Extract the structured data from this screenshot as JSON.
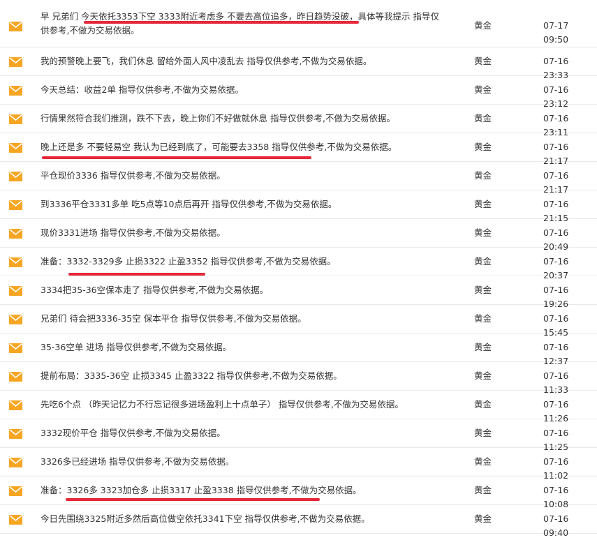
{
  "colors": {
    "icon": "#f6a623",
    "highlight": "#e5283a",
    "text": "#333333",
    "divider": "#e9e9e9"
  },
  "icon_name": "envelope-icon",
  "messages": [
    {
      "text": "早 兄弟们 今天依托3353下空 3333附近考虑多 不要去高位追多，昨日趋势没破，具体等我提示 指导仅供参考,不做为交易依据。",
      "category": "黄金",
      "time": "07-17 09:50",
      "highlighted": true
    },
    {
      "text": "我的预警晚上要飞，我们休息 留给外面人风中凌乱去 指导仅供参考,不做为交易依据。",
      "category": "黄金",
      "time": "07-16 23:33",
      "highlighted": false
    },
    {
      "text": "今天总结：收益2单 指导仅供参考,不做为交易依据。",
      "category": "黄金",
      "time": "07-16 23:12",
      "highlighted": false
    },
    {
      "text": "行情果然符合我们推测，跌不下去，晚上你们不好做就休息 指导仅供参考,不做为交易依据。",
      "category": "黄金",
      "time": "07-16 23:11",
      "highlighted": false
    },
    {
      "text": "晚上还是多 不要轻易空 我认为已经到底了，可能要去3358 指导仅供参考,不做为交易依据。",
      "category": "黄金",
      "time": "07-16 21:17",
      "highlighted": true
    },
    {
      "text": "平仓现价3336 指导仅供参考,不做为交易依据。",
      "category": "黄金",
      "time": "07-16 21:17",
      "highlighted": false
    },
    {
      "text": "到3336平仓3331多单 吃5点等10点后再开 指导仅供参考,不做为交易依据。",
      "category": "黄金",
      "time": "07-16 21:15",
      "highlighted": false
    },
    {
      "text": "现价3331进场 指导仅供参考,不做为交易依据。",
      "category": "黄金",
      "time": "07-16 20:49",
      "highlighted": false
    },
    {
      "text": "准备：3332-3329多 止损3322 止盈3352 指导仅供参考,不做为交易依据。",
      "category": "黄金",
      "time": "07-16 20:37",
      "highlighted": true
    },
    {
      "text": "3334把35-36空保本走了 指导仅供参考,不做为交易依据。",
      "category": "黄金",
      "time": "07-16 19:26",
      "highlighted": false
    },
    {
      "text": "兄弟们 待会把3336-35空 保本平仓 指导仅供参考,不做为交易依据。",
      "category": "黄金",
      "time": "07-16 15:45",
      "highlighted": false
    },
    {
      "text": "35-36空单 进场 指导仅供参考,不做为交易依据。",
      "category": "黄金",
      "time": "07-16 12:37",
      "highlighted": false
    },
    {
      "text": "提前布局：3335-36空 止损3345 止盈3322 指导仅供参考,不做为交易依据。",
      "category": "黄金",
      "time": "07-16 11:33",
      "highlighted": false
    },
    {
      "text": "先吃6个点 （昨天记忆力不行忘记很多进场盈利上十点单子） 指导仅供参考,不做为交易依据。",
      "category": "黄金",
      "time": "07-16 11:26",
      "highlighted": false
    },
    {
      "text": "3332现价平仓 指导仅供参考,不做为交易依据。",
      "category": "黄金",
      "time": "07-16 11:25",
      "highlighted": false
    },
    {
      "text": "3326多已经进场 指导仅供参考,不做为交易依据。",
      "category": "黄金",
      "time": "07-16 11:02",
      "highlighted": false
    },
    {
      "text": "准备：3326多 3323加仓多 止损3317 止盈3338 指导仅供参考,不做为交易依据。",
      "category": "黄金",
      "time": "07-16 10:08",
      "highlighted": true
    },
    {
      "text": "今日先围绕3325附近多然后高位做空依托3341下空 指导仅供参考,不做为交易依据。",
      "category": "黄金",
      "time": "07-16 09:40",
      "highlighted": false
    }
  ]
}
